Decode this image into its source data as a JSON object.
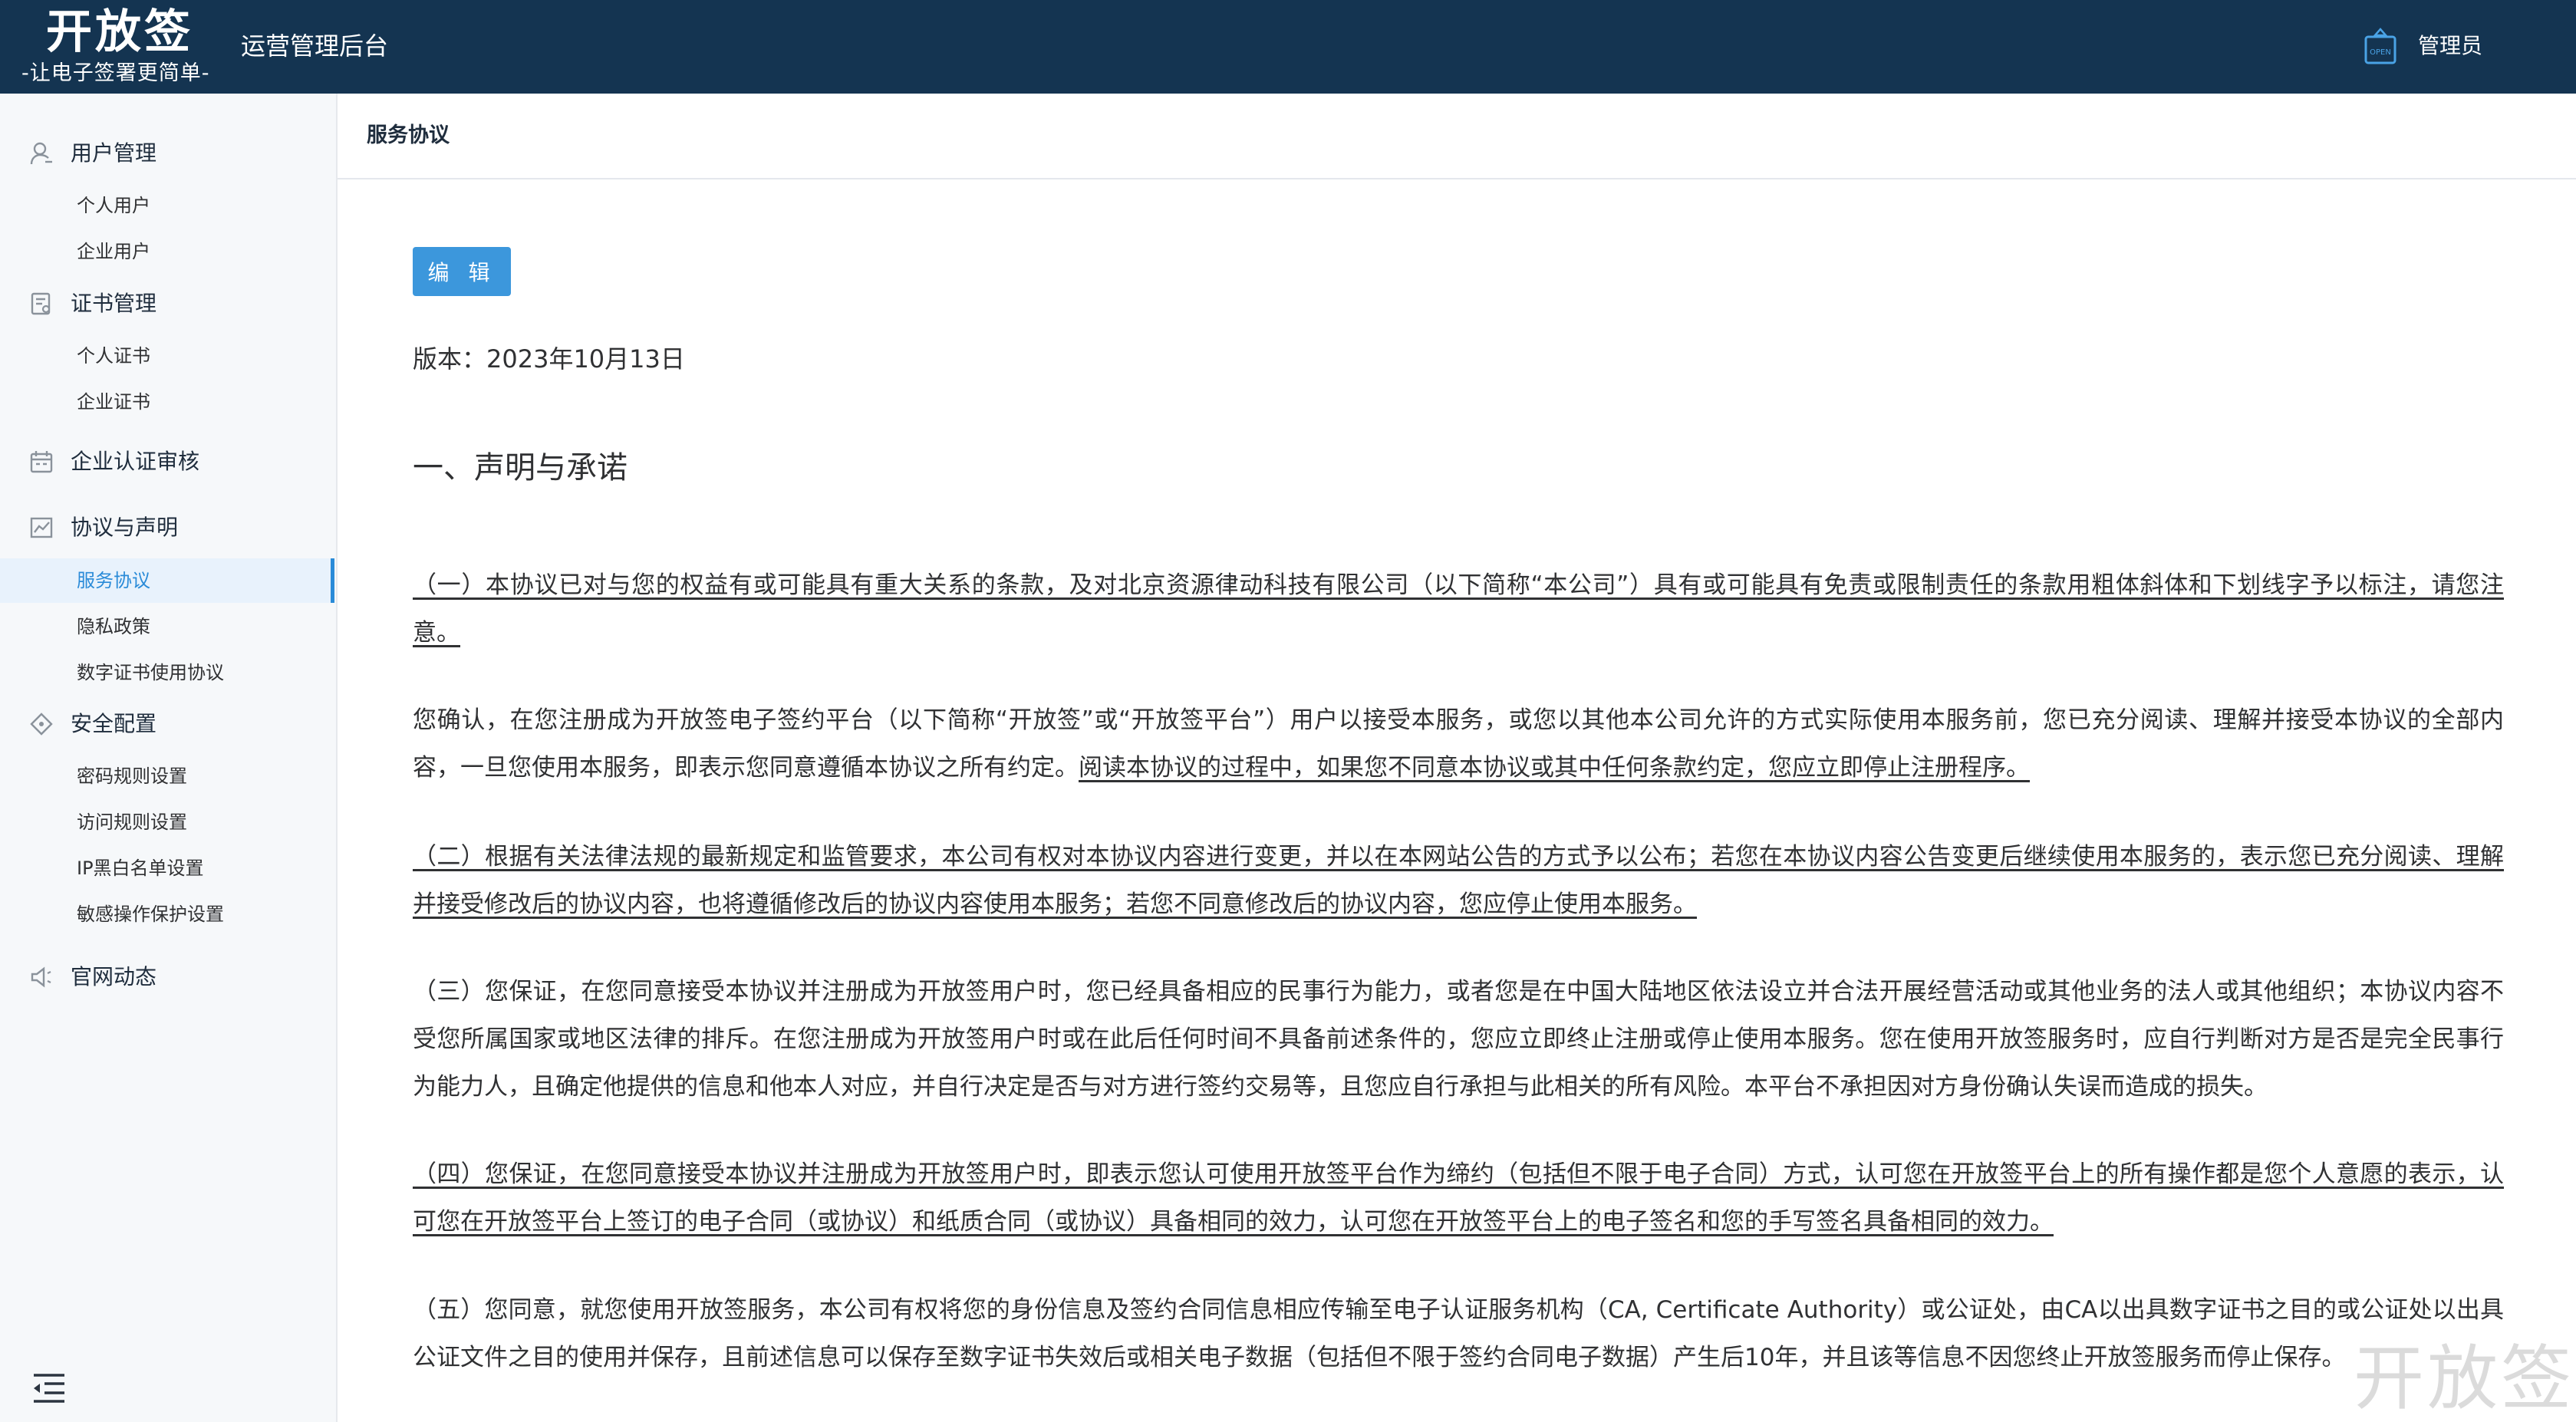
{
  "header": {
    "brand_title": "开放签",
    "brand_slogan": "-让电子签署更简单-",
    "app_name": "运营管理后台",
    "admin_label": "管理员",
    "admin_icon": "open-badge-icon",
    "background_color": "#143451"
  },
  "sidebar": {
    "groups": [
      {
        "label": "用户管理",
        "icon": "user-icon",
        "items": [
          "个人用户",
          "企业用户"
        ]
      },
      {
        "label": "证书管理",
        "icon": "certificate-icon",
        "items": [
          "个人证书",
          "企业证书"
        ]
      },
      {
        "label": "企业认证审核",
        "icon": "calendar-icon",
        "items": []
      },
      {
        "label": "协议与声明",
        "icon": "chart-line-icon",
        "items": [
          "服务协议",
          "隐私政策",
          "数字证书使用协议"
        ]
      },
      {
        "label": "安全配置",
        "icon": "diamond-icon",
        "items": [
          "密码规则设置",
          "访问规则设置",
          "IP黑白名单设置",
          "敏感操作保护设置"
        ]
      },
      {
        "label": "官网动态",
        "icon": "speaker-icon",
        "items": []
      }
    ],
    "active_item": "服务协议",
    "accent_color": "#2a8bd8",
    "collapse_icon": "menu-fold-icon"
  },
  "content": {
    "page_title": "服务协议",
    "edit_button": "编 辑",
    "version": "版本：2023年10月13日",
    "section_title": "一、声明与承诺",
    "p1": "（一）本协议已对与您的权益有或可能具有重大关系的条款，及对北京资源律动科技有限公司（以下简称“本公司”）具有或可能具有免责或限制责任的条款用粗体斜体和下划线字予以标注，请您注意。",
    "p2_a": "您确认，在您注册成为开放签电子签约平台（以下简称“开放签”或“开放签平台”）用户以接受本服务，或您以其他本公司允许的方式实际使用本服务前，您已充分阅读、理解并接受本协议的全部内容，一旦您使用本服务，即表示您同意遵循本协议之所有约定。",
    "p2_b": "阅读本协议的过程中，如果您不同意本协议或其中任何条款约定，您应立即停止注册程序。",
    "p3": "（二）根据有关法律法规的最新规定和监管要求，本公司有权对本协议内容进行变更，并以在本网站公告的方式予以公布；若您在本协议内容公告变更后继续使用本服务的，表示您已充分阅读、理解并接受修改后的协议内容，也将遵循修改后的协议内容使用本服务；若您不同意修改后的协议内容，您应停止使用本服务。",
    "p4": "（三）您保证，在您同意接受本协议并注册成为开放签用户时，您已经具备相应的民事行为能力，或者您是在中国大陆地区依法设立并合法开展经营活动或其他业务的法人或其他组织；本协议内容不受您所属国家或地区法律的排斥。在您注册成为开放签用户时或在此后任何时间不具备前述条件的，您应立即终止注册或停止使用本服务。您在使用开放签服务时，应自行判断对方是否是完全民事行为能力人，且确定他提供的信息和他本人对应，并自行决定是否与对方进行签约交易等，且您应自行承担与此相关的所有风险。本平台不承担因对方身份确认失误而造成的损失。",
    "p5": "（四）您保证，在您同意接受本协议并注册成为开放签用户时，即表示您认可使用开放签平台作为缔约（包括但不限于电子合同）方式，认可您在开放签平台上的所有操作都是您个人意愿的表示，认可您在开放签平台上签订的电子合同（或协议）和纸质合同（或协议）具备相同的效力，认可您在开放签平台上的电子签名和您的手写签名具备相同的效力。",
    "p6": "（五）您同意，就您使用开放签服务，本公司有权将您的身份信息及签约合同信息相应传输至电子认证服务机构（CA, Certificate Authority）或公证处，由CA以出具数字证书之目的或公证处以出具公证文件之目的使用并保存，且前述信息可以保存至数字证书失效后或相关电子数据（包括但不限于签约合同电子数据）产生后10年，并且该等信息不因您终止开放签服务而停止保存。",
    "watermark": "开放签"
  }
}
